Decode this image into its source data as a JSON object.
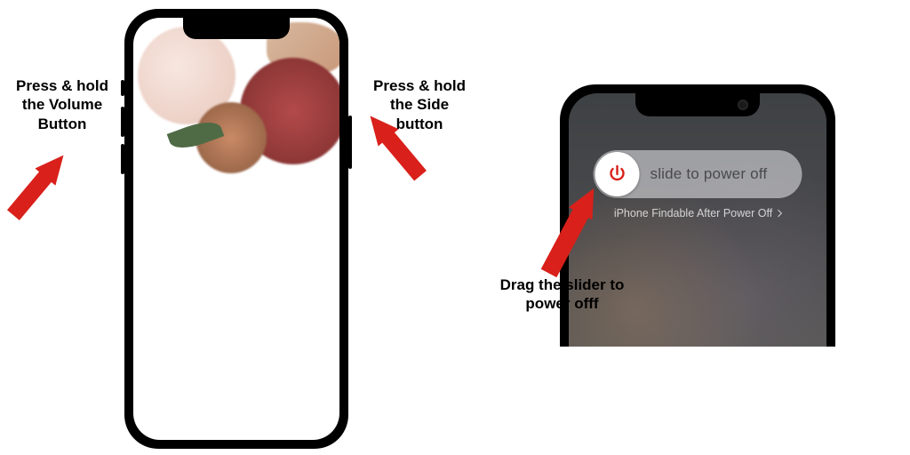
{
  "callouts": {
    "volume": "Press & hold the Volume Button",
    "side": "Press & hold the Side button",
    "drag": "Drag the slider to power offf"
  },
  "power_off_screen": {
    "slider_text": "slide to power off",
    "findable_text": "iPhone Findable After Power Off",
    "icon": "power-icon",
    "accent_color": "#d9201a"
  },
  "arrows": {
    "color": "#d9201a"
  }
}
